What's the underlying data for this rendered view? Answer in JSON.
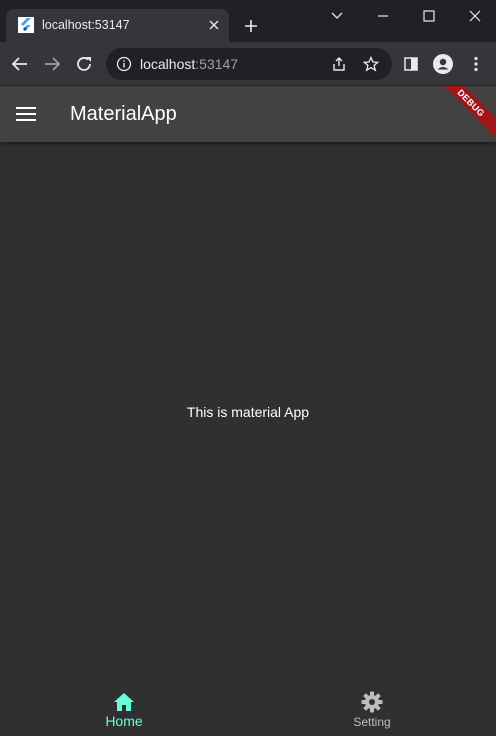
{
  "browser": {
    "tab": {
      "title": "localhost:53147",
      "favicon": "flutter-icon"
    },
    "address": {
      "host": "localhost",
      "port": ":53147"
    }
  },
  "app": {
    "title": "MaterialApp",
    "debug_banner": "DEBUG",
    "body_text": "This is material App",
    "bottom_nav": {
      "items": [
        {
          "label": "Home",
          "icon": "home-icon",
          "selected": true
        },
        {
          "label": "Setting",
          "icon": "settings-icon",
          "selected": false
        }
      ]
    },
    "colors": {
      "accent": "#64ffda",
      "appbar": "#424242",
      "background": "#303030",
      "debug": "#a31515"
    }
  }
}
